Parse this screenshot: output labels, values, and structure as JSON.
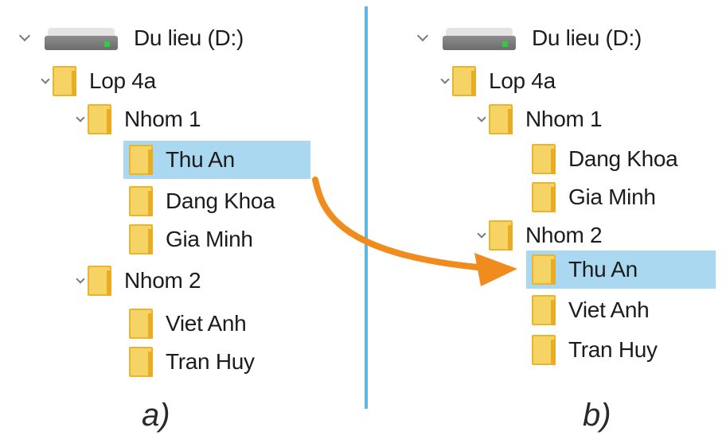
{
  "panels": [
    {
      "caption": "a)",
      "drive": "Du lieu (D:)",
      "root": "Lop 4a",
      "groups": [
        {
          "name": "Nhom 1",
          "members": [
            "Thu An",
            "Dang Khoa",
            "Gia Minh"
          ]
        },
        {
          "name": "Nhom 2",
          "members": [
            "Viet Anh",
            "Tran Huy"
          ]
        }
      ],
      "selected": "Thu An"
    },
    {
      "caption": "b)",
      "drive": "Du lieu (D:)",
      "root": "Lop 4a",
      "groups": [
        {
          "name": "Nhom 1",
          "members": [
            "Dang Khoa",
            "Gia Minh"
          ]
        },
        {
          "name": "Nhom 2",
          "members": [
            "Thu An",
            "Viet Anh",
            "Tran Huy"
          ]
        }
      ],
      "selected": "Thu An"
    }
  ],
  "colors": {
    "selection": "#a9d8f0",
    "divider": "#5ab8e4",
    "arrow": "#f08c1e",
    "folder": "#f6d365"
  },
  "icons": [
    "drive-icon",
    "folder-icon",
    "chevron-down-icon",
    "move-arrow"
  ]
}
